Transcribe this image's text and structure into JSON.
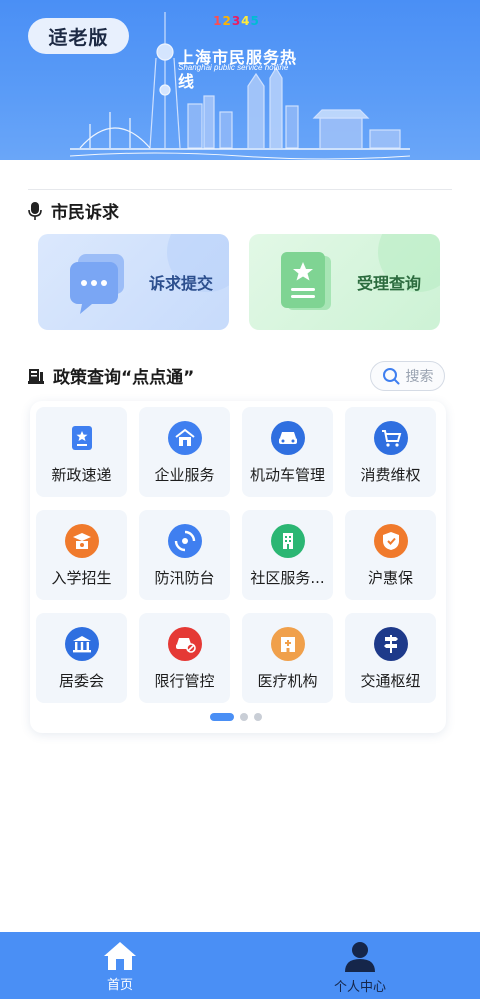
{
  "header": {
    "elder_mode_label": "适老版",
    "hotline_badge": [
      "1",
      "2",
      "3",
      "4",
      "5"
    ],
    "hotline_title": "上海市民服务热线",
    "hotline_subtitle": "Shanghai public service hotline",
    "colors": {
      "banner": "#4a8ff5"
    }
  },
  "appeal_section": {
    "title": "市民诉求",
    "icon": "microphone-icon",
    "cards": [
      {
        "label": "诉求提交",
        "icon": "chat-bubble-icon",
        "color": "#2c4f8e"
      },
      {
        "label": "受理查询",
        "icon": "document-star-icon",
        "color": "#2b6b3e"
      }
    ]
  },
  "policy_section": {
    "title": "政策查询“点点通”",
    "icon": "book-icon",
    "search_label": "搜索",
    "services": [
      {
        "label": "新政速递",
        "icon": "news-star-icon",
        "color": "#3f7ff0"
      },
      {
        "label": "企业服务",
        "icon": "building-icon",
        "color": "#3f7ff0"
      },
      {
        "label": "机动车管理",
        "icon": "car-icon",
        "color": "#2f6fe0"
      },
      {
        "label": "消费维权",
        "icon": "cart-icon",
        "color": "#2f6fe0"
      },
      {
        "label": "入学招生",
        "icon": "school-icon",
        "color": "#f07a2c"
      },
      {
        "label": "防汛防台",
        "icon": "typhoon-icon",
        "color": "#3f7ff0"
      },
      {
        "label": "社区服务...",
        "icon": "community-icon",
        "color": "#2bb673"
      },
      {
        "label": "沪惠保",
        "icon": "shield-icon",
        "color": "#f07a2c"
      },
      {
        "label": "居委会",
        "icon": "committee-icon",
        "color": "#2f6fe0"
      },
      {
        "label": "限行管控",
        "icon": "restricted-car-icon",
        "color": "#e53935"
      },
      {
        "label": "医疗机构",
        "icon": "hospital-icon",
        "color": "#f0a04b"
      },
      {
        "label": "交通枢纽",
        "icon": "signpost-icon",
        "color": "#1e3a8a"
      }
    ],
    "pager": {
      "pages": 3,
      "current": 1
    }
  },
  "bottom_nav": {
    "items": [
      {
        "label": "首页",
        "icon": "home-icon"
      },
      {
        "label": "个人中心",
        "icon": "user-icon"
      }
    ]
  }
}
